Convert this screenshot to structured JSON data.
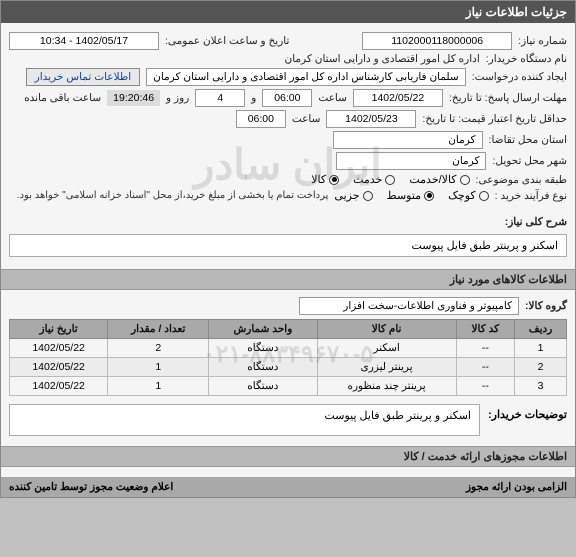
{
  "header": {
    "title": "جزئیات اطلاعات نیاز"
  },
  "form": {
    "need_no_label": "شماره نیاز:",
    "need_no": "1102000118000006",
    "announce_label": "تاریخ و ساعت اعلان عمومی:",
    "announce": "1402/05/17 - 10:34",
    "buyer_label": "نام دستگاه خریدار:",
    "buyer": "اداره کل امور اقتصادی و دارایی استان کرمان",
    "creator_label": "ایجاد کننده درخواست:",
    "creator": "سلمان فاریابی کارشناس اداره کل امور اقتصادی و دارایی استان کرمان",
    "contact_btn": "اطلاعات تماس خریدار",
    "deadline_label": "مهلت ارسال پاسخ: تا تاریخ:",
    "deadline_date": "1402/05/22",
    "saat": "ساعت",
    "deadline_time": "06:00",
    "va": "و",
    "days": "4",
    "rooz_va": "روز و",
    "remain_time": "19:20:46",
    "remain_label": "ساعت باقی مانده",
    "valid_label": "حداقل تاریخ اعتبار قیمت: تا تاریخ:",
    "valid_date": "1402/05/23",
    "valid_time": "06:00",
    "req_place_label": "استان محل تقاضا:",
    "req_place": "کرمان",
    "deliv_place_label": "شهر محل تحویل:",
    "deliv_place": "کرمان",
    "subject_class_label": "طبقه بندی موضوعی:",
    "radios_subject": [
      "کالا/خدمت",
      "خدمت",
      "کالا"
    ],
    "radios_subject_sel": 2,
    "process_label": "نوع فرآیند خرید :",
    "radios_process": [
      "کوچک",
      "متوسط",
      "جزیی"
    ],
    "radios_process_sel": 1,
    "process_note": "پرداخت تمام یا بخشی از مبلغ خرید،از محل \"اسناد خزانه اسلامی\" خواهد بود."
  },
  "overall": {
    "label": "شرح کلی نیاز:",
    "text": "اسکنر و پرینتر طبق فایل پیوست"
  },
  "goods_section": "اطلاعات کالاهای مورد نیاز",
  "group": {
    "label": "گروه کالا:",
    "value": "کامپیوتر و فناوری اطلاعات-سخت افزار"
  },
  "table": {
    "headers": [
      "ردیف",
      "کد کالا",
      "نام کالا",
      "واحد شمارش",
      "تعداد / مقدار",
      "تاریخ نیاز"
    ],
    "rows": [
      [
        "1",
        "--",
        "اسکنر",
        "دستگاه",
        "2",
        "1402/05/22"
      ],
      [
        "2",
        "--",
        "پرینتر لیزری",
        "دستگاه",
        "1",
        "1402/05/22"
      ],
      [
        "3",
        "--",
        "پرینتر چند منظوره",
        "دستگاه",
        "1",
        "1402/05/22"
      ]
    ]
  },
  "buyer_notes": {
    "label": "توضیحات خریدار:",
    "text": "اسکنر و پرینتر طبق فایل پیوست"
  },
  "license_section": "اطلاعات مجوزهای ارائه خدمت / کالا",
  "license_footer": {
    "right": "الزامی بودن ارائه مجوز",
    "left": "اعلام وضعیت مجوز توسط تامین کننده"
  },
  "chart_data": {
    "type": "table",
    "title": "اطلاعات کالاهای مورد نیاز",
    "columns": [
      "ردیف",
      "کد کالا",
      "نام کالا",
      "واحد شمارش",
      "تعداد / مقدار",
      "تاریخ نیاز"
    ],
    "data": [
      {
        "row": 1,
        "code": "--",
        "name": "اسکنر",
        "unit": "دستگاه",
        "qty": 2,
        "date": "1402/05/22"
      },
      {
        "row": 2,
        "code": "--",
        "name": "پرینتر لیزری",
        "unit": "دستگاه",
        "qty": 1,
        "date": "1402/05/22"
      },
      {
        "row": 3,
        "code": "--",
        "name": "پرینتر چند منظوره",
        "unit": "دستگاه",
        "qty": 1,
        "date": "1402/05/22"
      }
    ]
  }
}
